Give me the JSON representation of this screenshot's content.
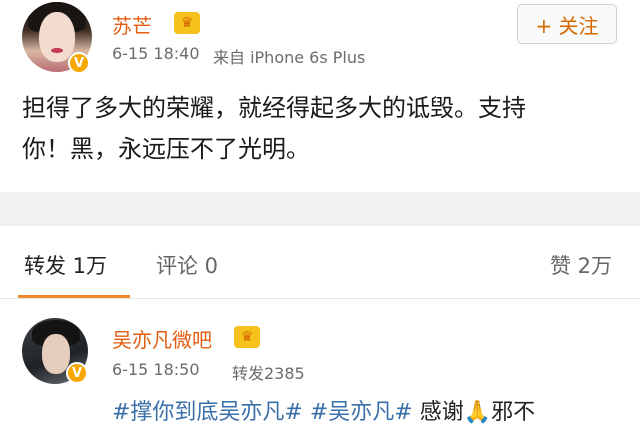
{
  "post": {
    "author": "苏芒",
    "time": "6-15 18:40",
    "source": "来自 iPhone 6s Plus",
    "follow_label": "+ 关注",
    "text_line1": "担得了多大的荣耀，就经得起多大的诋毁。支持",
    "text_line2": "你！黑，永远压不了光明。"
  },
  "tabs": {
    "repost": "转发 1万",
    "comment": "评论 0",
    "like": "赞 2万"
  },
  "repost_item": {
    "author": "吴亦凡微吧",
    "time": "6-15 18:50",
    "repost_count": "转发2385",
    "hashtag1": "#撑你到底吴亦凡#",
    "hashtag2": "#吴亦凡#",
    "text_after": "感谢🙏邪不"
  },
  "icons": {
    "verified": "V",
    "crown": "♛"
  },
  "colors": {
    "name": "#e35d10",
    "link": "#3a6fa8",
    "accent": "#f08a25",
    "verified": "#f7a800"
  }
}
